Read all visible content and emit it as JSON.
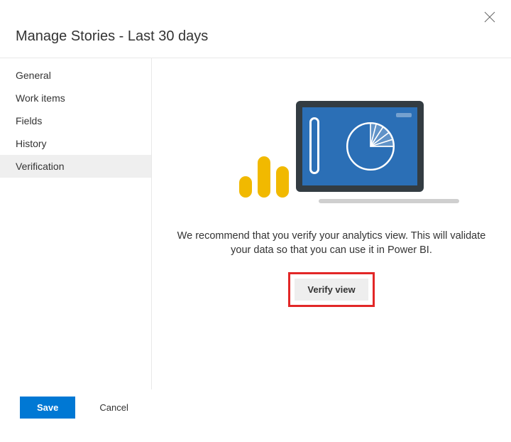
{
  "header": {
    "title": "Manage Stories - Last 30 days"
  },
  "sidebar": {
    "items": [
      {
        "label": "General"
      },
      {
        "label": "Work items"
      },
      {
        "label": "Fields"
      },
      {
        "label": "History"
      },
      {
        "label": "Verification"
      }
    ],
    "selected_index": 4
  },
  "main": {
    "message": "We recommend that you verify your analytics view. This will validate your data so that you can use it in Power BI.",
    "verify_label": "Verify view"
  },
  "footer": {
    "save_label": "Save",
    "cancel_label": "Cancel"
  }
}
